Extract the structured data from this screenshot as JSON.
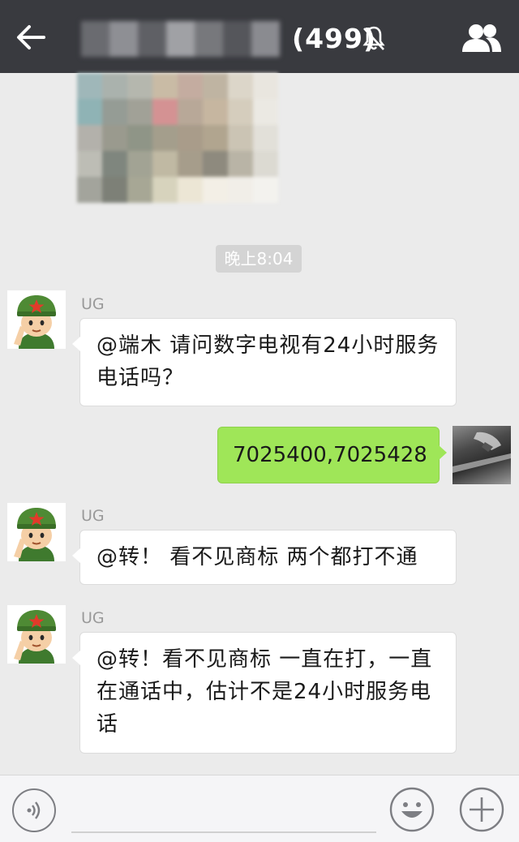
{
  "header": {
    "back_icon": "arrow-left-icon",
    "member_count": "(499)",
    "mute_icon": "bell-off-icon",
    "members_icon": "group-icon",
    "background": "#393a3f"
  },
  "timestamp": "晚上8:04",
  "messages": [
    {
      "sender": "UG",
      "text_lines": [
        "@端木 请问数字电视有24小时服务",
        "电话吗？"
      ]
    },
    {
      "sender": "me",
      "text": "7025400,7025428"
    },
    {
      "sender": "UG",
      "text_lines": [
        "@转！ 看不见商标 两个都打不通"
      ]
    },
    {
      "sender": "UG",
      "text_lines": [
        "@转！看不见商标 一直在打，一直",
        "在通话中，估计不是24小时服务电",
        "话"
      ]
    }
  ],
  "input_bar": {
    "voice_icon": "voice-icon",
    "emoji_icon": "smile-icon",
    "more_icon": "plus-icon"
  },
  "colors": {
    "own_bubble": "#9fe658",
    "chat_background": "#ebebeb"
  }
}
